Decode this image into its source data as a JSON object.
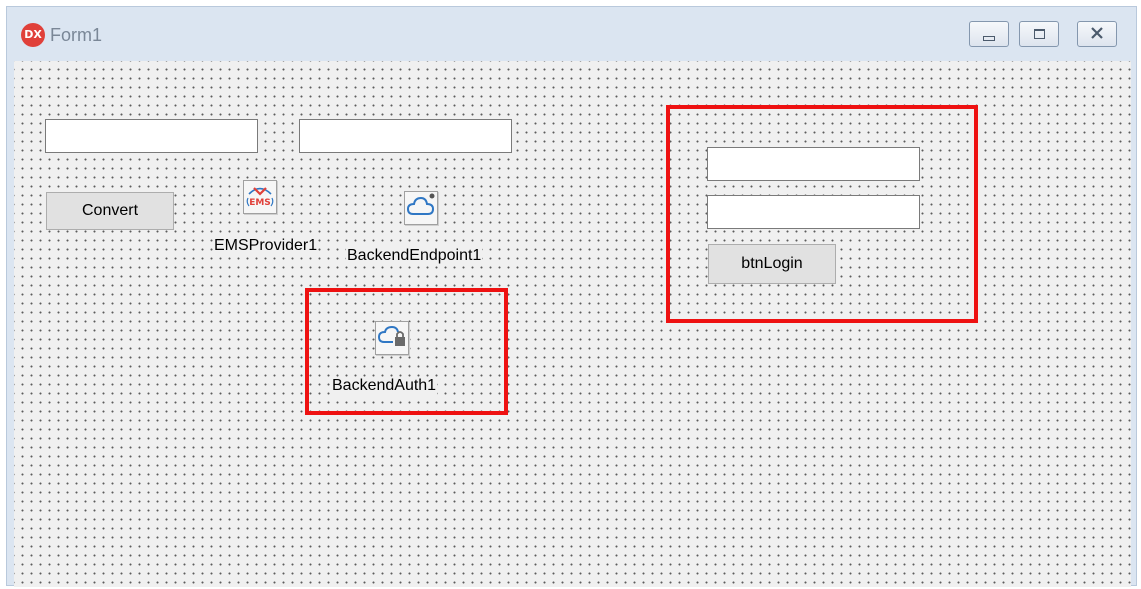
{
  "window": {
    "title": "Form1",
    "app_icon_text": "DX",
    "controls": [
      "minimize-icon",
      "maximize-icon",
      "close-icon"
    ]
  },
  "form": {
    "edit1_value": "",
    "edit2_value": "",
    "convert_label": "Convert",
    "login_username_value": "",
    "login_password_value": "",
    "login_button_label": "btnLogin"
  },
  "components": {
    "ems_provider": {
      "label": "EMSProvider1",
      "icon": "ems-icon"
    },
    "backend_endpoint": {
      "label": "BackendEndpoint1",
      "icon": "cloud-endpoint-icon"
    },
    "backend_auth": {
      "label": "BackendAuth1",
      "icon": "cloud-lock-icon"
    }
  },
  "colors": {
    "highlight": "#ee1111",
    "ems_red": "#e0403a",
    "cloud_blue": "#2f77c4"
  }
}
